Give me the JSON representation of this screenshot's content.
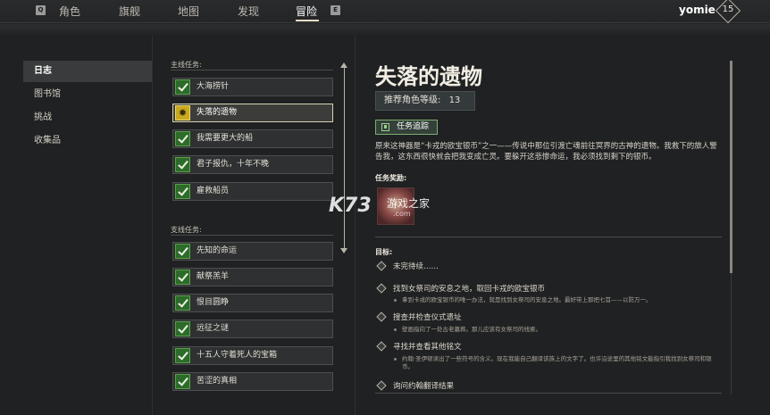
{
  "topnav": {
    "left_key": "Q",
    "right_key": "E",
    "tabs": [
      "角色",
      "旗舰",
      "地图",
      "发现",
      "冒险"
    ],
    "active_tab": "冒险",
    "username": "yomie",
    "level": "15"
  },
  "sidebar": {
    "items": [
      {
        "label": "日志",
        "active": true
      },
      {
        "label": "图书馆",
        "active": false
      },
      {
        "label": "挑战",
        "active": false
      },
      {
        "label": "收集品",
        "active": false
      }
    ]
  },
  "quests": {
    "main_label": "主线任务:",
    "main": [
      "大海捞针",
      "失落的遗物",
      "我需要更大的船",
      "君子报仇，十年不晚",
      "雇救船员"
    ],
    "selected_index": 1,
    "side_label": "支线任务:",
    "side": [
      "先知的命运",
      "献祭羔羊",
      "恨目圆睁",
      "远征之谜",
      "十五人守着死人的宝箱",
      "苦涩的真相"
    ]
  },
  "detail": {
    "title": "失落的遗物",
    "recommended_label": "推荐角色等级:",
    "recommended_level": "13",
    "track_button": "任务追踪",
    "description": "原来这神器是“卡戎的欧宝银币”之一——传说中那位引渡亡魂前往冥界的古神的遗物。我救下的旅人警告我，这东西很快就会把我变成亡灵。要躲开这悲惨命运，我必须找到剩下的银币。",
    "reward_label": "任务奖励:",
    "objectives_label": "目标:",
    "objectives": [
      {
        "text": "未完待续……",
        "sub": ""
      },
      {
        "text": "找到女祭司的安息之地，取回卡戎的欧宝银币",
        "sub": "拿到卡戎的欧宝银币的唯一办法，就是找到女祭司的安息之地。最好带上那把七首——以防万一。"
      },
      {
        "text": "搜查并检查仪式遗址",
        "sub": "壁画指向了一处古老墓葬。那儿应该有女祭司的线索。"
      },
      {
        "text": "寻找并查看其他铭文",
        "sub": "约翰·圣伊顿读出了一些符号的含义。现在我能自己翻译该族上的文字了。也许沿途里的其他铭文能指引我找到女祭司和银币。"
      },
      {
        "text": "询问约翰翻译结果",
        "sub": ""
      }
    ]
  },
  "watermark": {
    "logo": "K73",
    "text": "游戏之家",
    "url": ".com"
  },
  "colors": {
    "background": "#1f2122",
    "accent_green": "#5aa04c",
    "selected_border": "#d8d0b0",
    "gold_icon": "#c8a820"
  }
}
